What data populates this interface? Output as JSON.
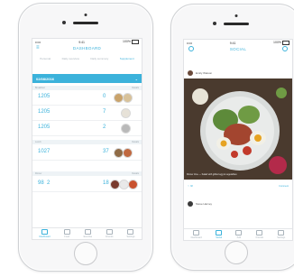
{
  "left_phone": {
    "status": {
      "carrier": "•••••",
      "time": "9:41",
      "battery": "100%"
    },
    "title": "DASHBOARD",
    "tabs": [
      "Personal",
      "Daily overview",
      "Daily summary",
      "Supplement"
    ],
    "date": "02/08/2016",
    "sections": [
      {
        "name": "Breakfast",
        "action": "Details"
      },
      {
        "name": "Lunch",
        "action": "Details"
      },
      {
        "name": "Dinner",
        "action": "Details"
      }
    ],
    "rows": [
      {
        "a": "120",
        "b": "5",
        "c": "0"
      },
      {
        "a": "120",
        "b": "5",
        "c": "7"
      },
      {
        "a": "120",
        "b": "5",
        "c": "2"
      },
      {
        "a": "102",
        "b": "7",
        "c": "37"
      },
      {
        "a": "98",
        "b": "2",
        "c": "18"
      }
    ],
    "bottom_nav": [
      "Dashboard",
      "Food",
      "Exercise",
      "Friends",
      "Settings"
    ]
  },
  "right_phone": {
    "status": {
      "carrier": "•••••",
      "time": "9:41",
      "battery": "100%"
    },
    "title": "SOCIAL",
    "post1_user": "Emily Watson",
    "caption": "Dinner time — Salad with grilled egg & vegetables",
    "likes": "38",
    "comments": "Comment",
    "post2_user": "Steve Harvey",
    "bottom_nav": [
      "Dashboard",
      "Social",
      "Add",
      "Friends",
      "Settings"
    ]
  },
  "colors": {
    "accent": "#3bb2db",
    "phone": "#f7f7f8",
    "border": "#cfd1d4"
  }
}
